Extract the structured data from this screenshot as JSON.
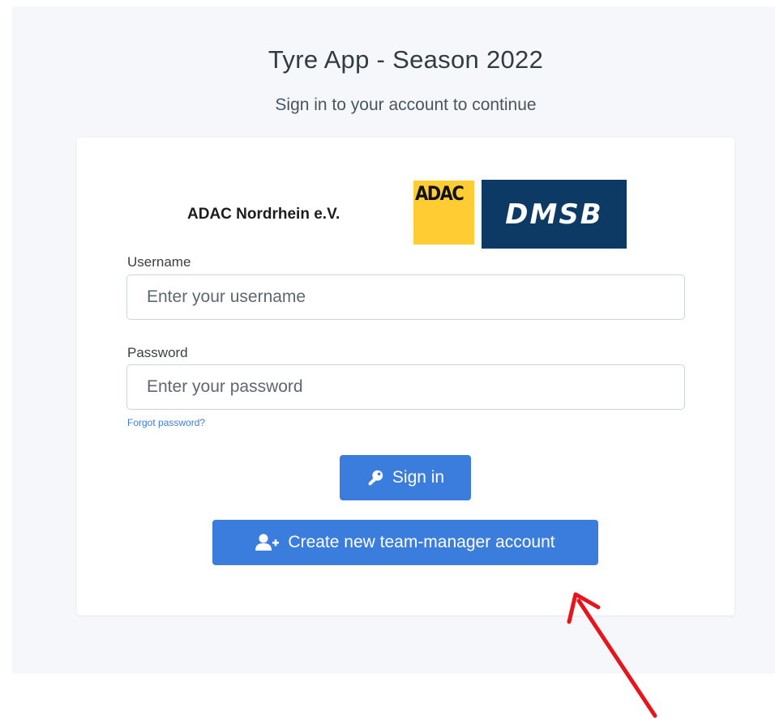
{
  "header": {
    "title": "Tyre App - Season 2022",
    "subtitle": "Sign in to your account to continue"
  },
  "logos": {
    "org_name": "ADAC Nordrhein e.V.",
    "adac_text": "ADAC",
    "dmsb_text": "DMSB"
  },
  "form": {
    "username_label": "Username",
    "username_placeholder": "Enter your username",
    "username_value": "",
    "password_label": "Password",
    "password_placeholder": "Enter your password",
    "password_value": "",
    "forgot_link": "Forgot password?"
  },
  "buttons": {
    "sign_in_label": "Sign in",
    "sign_in_icon": "key-icon",
    "create_account_label": "Create new team-manager account",
    "create_account_icon": "user-plus-icon"
  },
  "annotation": {
    "arrow_color": "#e8141b"
  },
  "colors": {
    "accent": "#3b7ddd",
    "background": "#f5f7fb",
    "adac_yellow": "#ffcc33",
    "dmsb_navy": "#0d3a64"
  }
}
